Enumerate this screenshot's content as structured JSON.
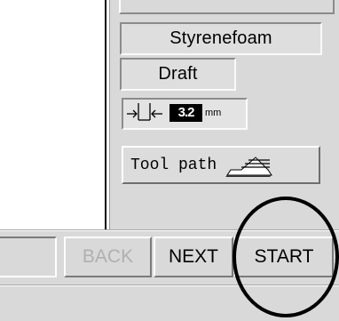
{
  "settings": {
    "material": "Styrenefoam",
    "quality": "Draft",
    "depth": {
      "value": "3.2",
      "unit": "mm",
      "icon": "cut-depth-icon"
    },
    "toolpath": {
      "label": "Tool path",
      "icon": "toolpath-layers-icon"
    }
  },
  "nav": {
    "back_label": "BACK",
    "next_label": "NEXT",
    "start_label": "START"
  },
  "colors": {
    "panel_bg": "#d9d9d9",
    "disabled_text": "#b0b0b0",
    "depth_value_bg": "#000000",
    "depth_value_text": "#ffffff",
    "highlight_circle": "#000000"
  }
}
